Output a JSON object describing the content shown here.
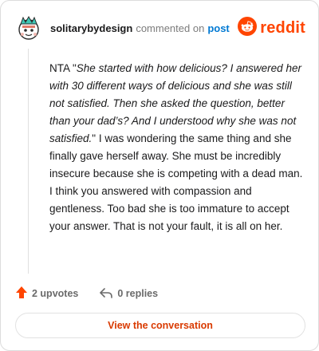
{
  "header": {
    "username": "solitarybydesign",
    "commented_text": "commented on",
    "post_link": "post",
    "brand": "reddit",
    "avatar_icon": "snoo-avatar-icon",
    "brand_icon": "reddit-logo-icon",
    "accent_color": "#ff4500",
    "link_color": "#0079d3"
  },
  "comment": {
    "prefix": "NTA \"",
    "quote": "She started with how delicious? I answered her with 30 different ways of delicious and she was still not satisfied. Then she asked the question, better than your dad’s? And I understood why she was not satisfied.",
    "suffix": "\" I was wondering the same thing and she finally gave herself away. She must be incredibly insecure because she is competing with a dead man. I think you answered with compassion and gentleness. Too bad she is too immature to accept your answer. That is not your fault, it is all on her."
  },
  "actions": {
    "upvotes_label": "2 upvotes",
    "upvote_icon": "upvote-arrow-icon",
    "upvote_color": "#ff4500",
    "replies_label": "0 replies",
    "reply_icon": "reply-arrow-icon"
  },
  "footer": {
    "view_button_label": "View the conversation",
    "view_button_color": "#d93a00"
  }
}
